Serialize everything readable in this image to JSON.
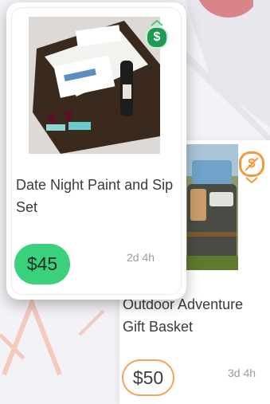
{
  "cards": [
    {
      "title": "Date Night Paint and Sip Set",
      "price": "$45",
      "time": "2d 4h",
      "badge_icon": "dollar-coin-icon",
      "badge_symbol": "$",
      "accent": "#3bd07c"
    },
    {
      "title": "Outdoor Adventure Gift Basket",
      "price": "$50",
      "time": "3d 4h",
      "badge_icon": "no-dollar-coin-icon",
      "badge_symbol": "$",
      "accent": "#f3a45f"
    }
  ],
  "colors": {
    "background": "#f3f2f6",
    "swipe_red": "#ee6a4d",
    "green": "#3bd07c",
    "orange": "#f3a45f"
  }
}
